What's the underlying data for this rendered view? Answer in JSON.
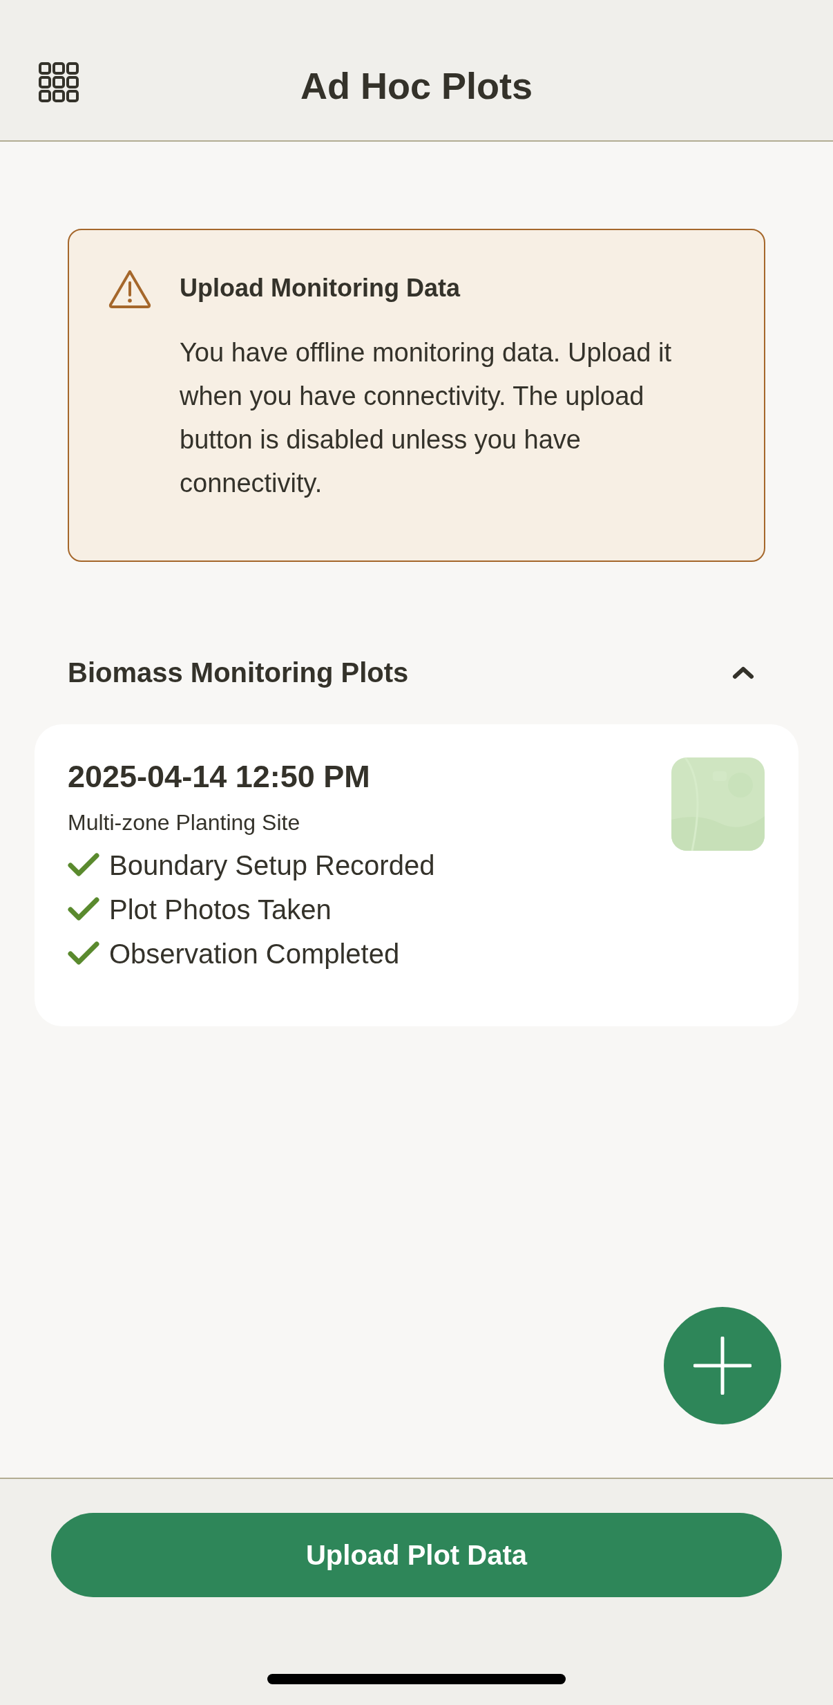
{
  "header": {
    "title": "Ad Hoc Plots"
  },
  "alert": {
    "title": "Upload Monitoring Data",
    "message": "You have offline monitoring data. Upload it when you have connectivity. The upload button is disabled unless you have connectivity."
  },
  "section": {
    "title": "Biomass Monitoring Plots",
    "expanded": true
  },
  "plots": [
    {
      "datetime": "2025-04-14 12:50 PM",
      "site": "Multi-zone Planting Site",
      "steps": [
        {
          "label": "Boundary Setup Recorded",
          "completed": true
        },
        {
          "label": "Plot Photos Taken",
          "completed": true
        },
        {
          "label": "Observation Completed",
          "completed": true
        }
      ]
    }
  ],
  "upload_button": {
    "label": "Upload Plot Data",
    "disabled": false
  }
}
